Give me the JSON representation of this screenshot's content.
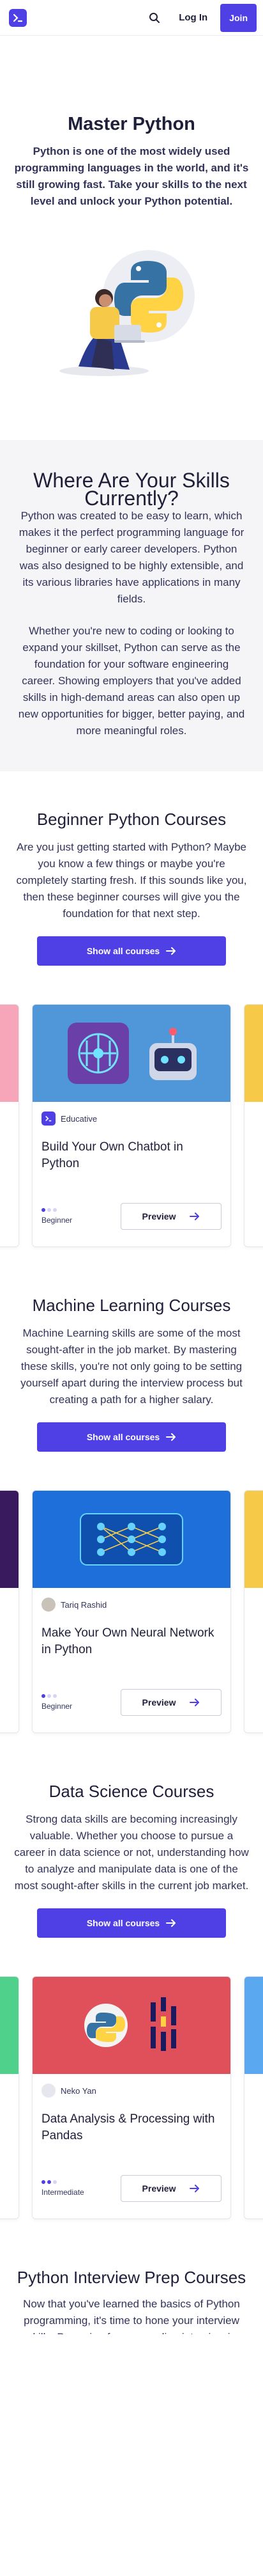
{
  "header": {
    "login_label": "Log In",
    "join_label": "Join"
  },
  "hero": {
    "title": "Master Python",
    "description": "Python is one of the most widely used programming languages in the world, and it's still growing fast. Take your skills to the next level and unlock your Python potential."
  },
  "skills": {
    "title_line1": "Where Are Your Skills",
    "title_line2": "Currently?",
    "paragraph1": "Python was created to be easy to learn, which makes it the perfect programming language for beginner or early career developers. Python was also designed to be highly extensible, and its various libraries have applications in many fields.",
    "paragraph2": "Whether you're new to coding or looking to expand your skillset, Python can serve as the foundation for your software engineering career. Showing employers that you've added skills in high-demand areas can also open up new opportunities for bigger, better paying, and more meaningful roles."
  },
  "sections": [
    {
      "title": "Beginner Python Courses",
      "description": "Are you just getting started with Python? Maybe you know a few things or maybe you're completely starting fresh. If this sounds like you, then these beginner courses will give you the foundation for that next step.",
      "button_label": "Show all courses",
      "card": {
        "author": "Educative",
        "title": "Build Your Own Chatbot in Python",
        "level": "Beginner",
        "preview_label": "Preview",
        "image_bg": "#4f97d9"
      }
    },
    {
      "title": "Machine Learning Courses",
      "description": "Machine Learning skills are some of the most sought-after in the job market. By mastering these skills, you're not only going to be setting yourself apart during the interview process but creating a path for a higher salary.",
      "button_label": "Show all courses",
      "card": {
        "author": "Tariq Rashid",
        "title": "Make Your Own Neural Network in Python",
        "level": "Beginner",
        "preview_label": "Preview",
        "image_bg": "#1e6fd9"
      }
    },
    {
      "title": "Data Science Courses",
      "description": "Strong data skills are becoming increasingly valuable. Whether you choose to pursue a career in data science or not, understanding how to analyze and manipulate data is one of the most sought-after skills in the current job market.",
      "button_label": "Show all courses",
      "card": {
        "author": "Neko Yan",
        "title": "Data Analysis & Processing with Pandas",
        "level": "Intermediate",
        "preview_label": "Preview",
        "image_bg": "#e0505a"
      }
    }
  ],
  "interview": {
    "title": "Python Interview Prep Courses",
    "description": "Now that you've learned the basics of Python programming, it's time to hone your interview skills. Preparing for your coding interview is crucial so you can practice"
  },
  "colors": {
    "brand": "#4f40e5",
    "text": "#1f1f3a"
  }
}
